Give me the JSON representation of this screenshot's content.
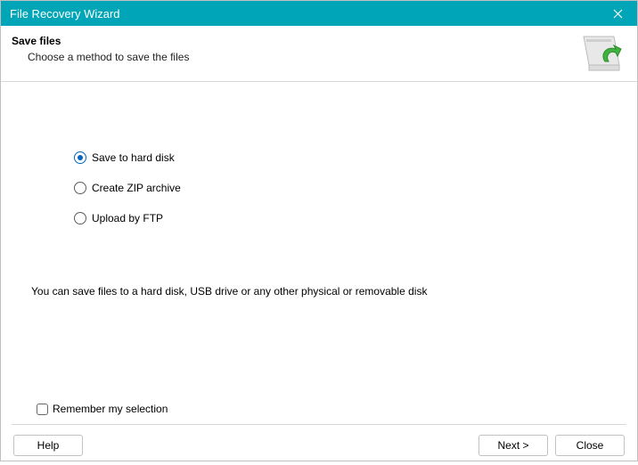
{
  "titlebar": {
    "title": "File Recovery Wizard"
  },
  "header": {
    "heading": "Save files",
    "subheading": "Choose a method to save the files"
  },
  "options": [
    {
      "label": "Save to hard disk",
      "checked": true
    },
    {
      "label": "Create ZIP archive",
      "checked": false
    },
    {
      "label": "Upload by FTP",
      "checked": false
    }
  ],
  "description": "You can save files to a hard disk, USB drive or any other physical or removable disk",
  "remember": {
    "label": "Remember my selection",
    "checked": false
  },
  "buttons": {
    "help": "Help",
    "next": "Next >",
    "close": "Close"
  }
}
